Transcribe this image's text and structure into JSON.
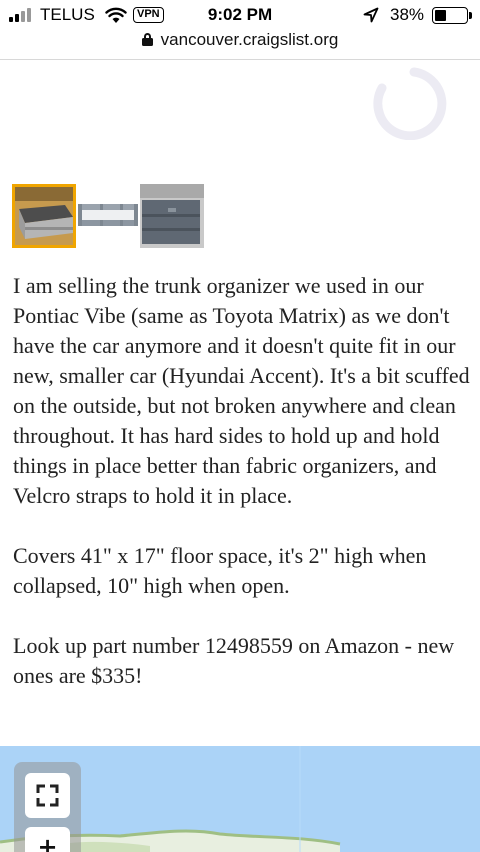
{
  "status_bar": {
    "carrier": "TELUS",
    "vpn": "VPN",
    "time": "9:02 PM",
    "battery_percent": "38%",
    "battery_level": 0.38
  },
  "url_bar": {
    "url": "vancouver.craigslist.org"
  },
  "gallery": {
    "thumbnails": [
      {
        "label": "thumbnail 1",
        "selected": true
      },
      {
        "label": "thumbnail 2",
        "selected": false
      },
      {
        "label": "thumbnail 3",
        "selected": false
      }
    ],
    "accent": "#f0a500"
  },
  "posting": {
    "paragraphs": [
      "I am selling the trunk organizer we used in our Pontiac Vibe (same as Toyota Matrix) as we don't have the car anymore and it doesn't quite fit in our new, smaller car (Hyundai Accent). It's a bit scuffed on the outside, but not broken anywhere and clean throughout. It has hard sides to hold up and hold things in place better than fabric organizers, and Velcro straps to hold it in place.",
      "Covers 41\" x 17\" floor space, it's 2\" high when collapsed, 10\" high when open.",
      "Look up part number 12498559 on Amazon - new ones are $335!"
    ]
  },
  "map": {
    "water_color": "#abd3f7",
    "controls": {
      "fullscreen_icon": "fullscreen-icon",
      "zoom_in_label": "+"
    }
  }
}
